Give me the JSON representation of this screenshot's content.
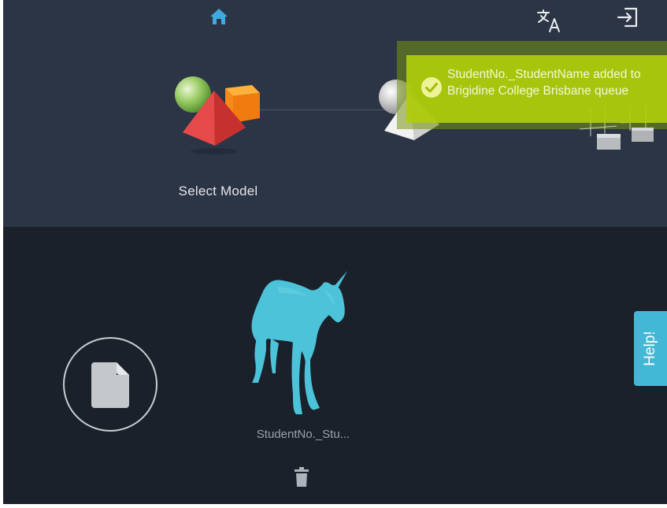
{
  "nav": {
    "home_icon": "home-icon",
    "translate_icon": "translate-icon",
    "logout_icon": "logout-icon"
  },
  "steps": {
    "select_model_label": "Select Model"
  },
  "notification": {
    "icon": "check-circle-icon",
    "message": "StudentNo._StudentName added to Brigidine College Brisbane queue"
  },
  "workspace": {
    "file_upload_icon": "file-icon",
    "model_name": "StudentNo._Stu...",
    "delete_icon": "trash-icon",
    "help_label": "Help!"
  },
  "colors": {
    "top_panel": "#2c3545",
    "bottom_panel": "#1b212a",
    "accent_blue": "#43b8d6",
    "model_cyan": "#4cc3d9",
    "toast_green": "#afcd0a"
  }
}
